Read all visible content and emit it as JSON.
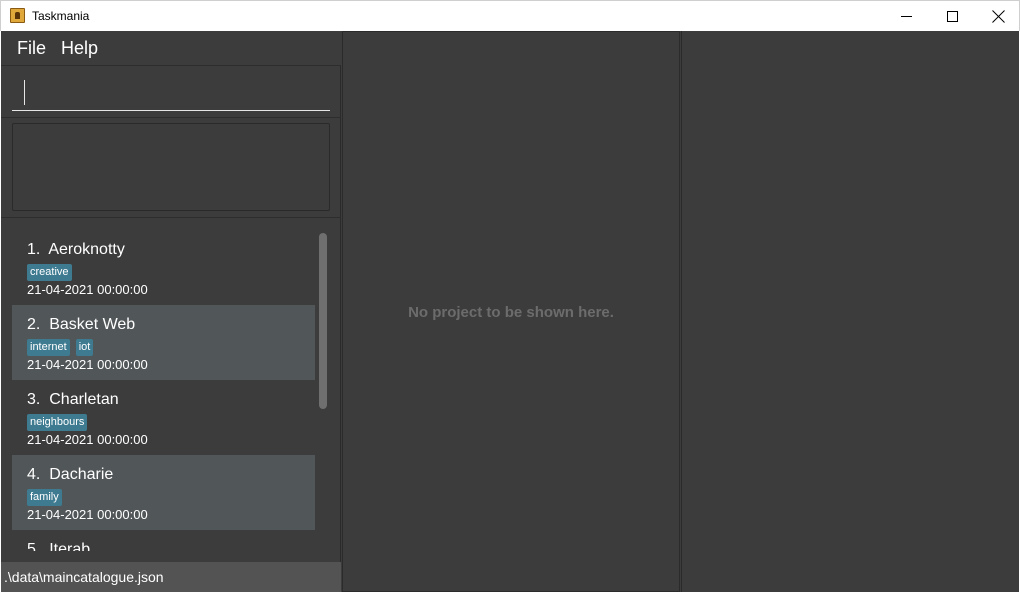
{
  "window": {
    "title": "Taskmania",
    "app_icon": "taskmania-app-icon",
    "controls": [
      "minimize-icon",
      "maximize-icon",
      "close-icon"
    ]
  },
  "menu": {
    "file_label": "File",
    "help_label": "Help"
  },
  "command_box": {
    "value": "",
    "placeholder": ""
  },
  "result_display": {
    "text": ""
  },
  "projects": [
    {
      "index": "1.",
      "name": "Aeroknotty",
      "tags": [
        "creative"
      ],
      "date": "21-04-2021 00:00:00"
    },
    {
      "index": "2.",
      "name": "Basket Web",
      "tags": [
        "internet",
        "iot"
      ],
      "date": "21-04-2021 00:00:00"
    },
    {
      "index": "3.",
      "name": "Charletan",
      "tags": [
        "neighbours"
      ],
      "date": "21-04-2021 00:00:00"
    },
    {
      "index": "4.",
      "name": "Dacharie",
      "tags": [
        "family"
      ],
      "date": "21-04-2021 00:00:00"
    },
    {
      "index": "5.",
      "name": "Iterab",
      "tags": [],
      "date": ""
    }
  ],
  "status_bar": {
    "file_path": ".\\data\\maincatalogue.json"
  },
  "project_panel": {
    "placeholder": "No project to be shown here."
  },
  "colors": {
    "background": "#3c3c3c",
    "card_alt": "#515658",
    "tag": "#3e7b91",
    "status_bar": "#535353",
    "placeholder_text": "#6c6c6c"
  }
}
